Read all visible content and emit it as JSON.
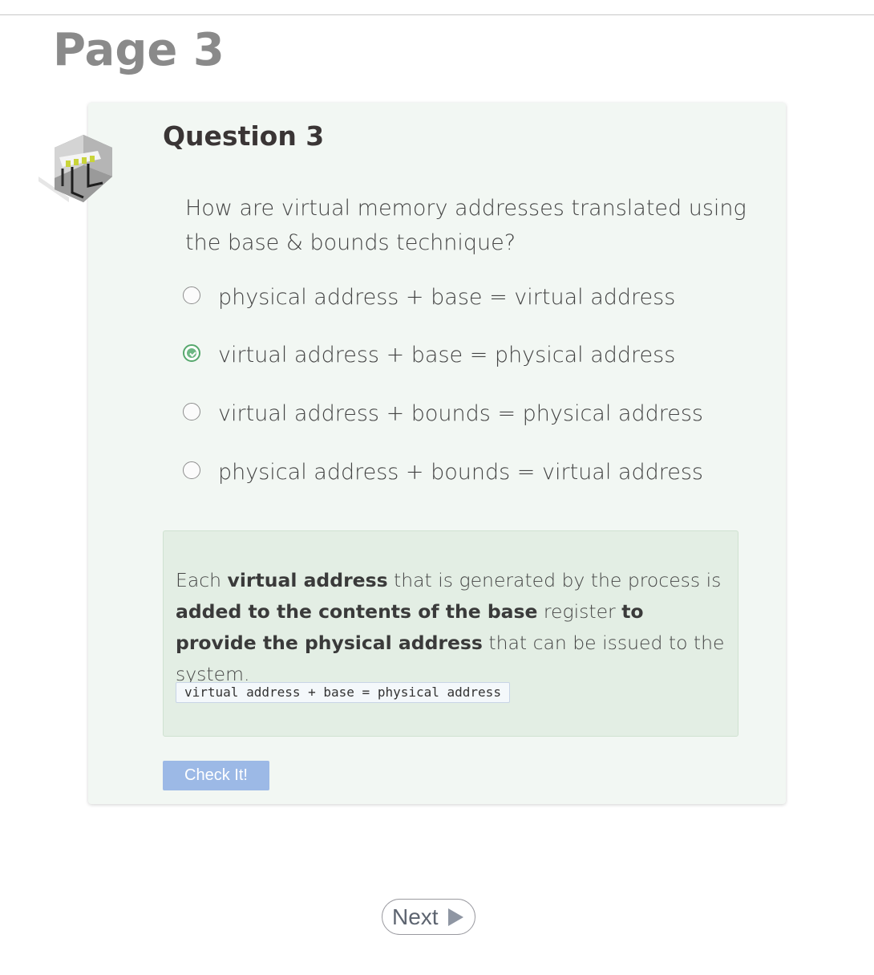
{
  "page": {
    "title": "Page 3"
  },
  "question": {
    "heading": "Question 3",
    "prompt": "How are virtual memory addresses translated using the base & bounds technique?",
    "icon": "server-cube-icon",
    "choices": [
      {
        "label": "physical address + base = virtual address",
        "selected": false
      },
      {
        "label": "virtual address + base = physical address",
        "selected": true
      },
      {
        "label": "virtual address + bounds = physical address",
        "selected": false
      },
      {
        "label": "physical address + bounds = virtual address",
        "selected": false
      }
    ]
  },
  "feedback": {
    "t1": "Each ",
    "b1": "virtual address",
    "t2": " that is generated by the process is ",
    "b2": "added to the contents of the base",
    "t3": " register ",
    "b3": "to provide the physical address",
    "t4": " that can be issued to the system.",
    "code": "virtual address + base = physical address"
  },
  "actions": {
    "check_label": "Check It!",
    "next_label": "Next"
  },
  "colors": {
    "card_bg": "#f2f7f3",
    "feedback_bg": "#e3eee4",
    "selected_radio": "#6db783",
    "check_button": "#9cb9e6"
  }
}
